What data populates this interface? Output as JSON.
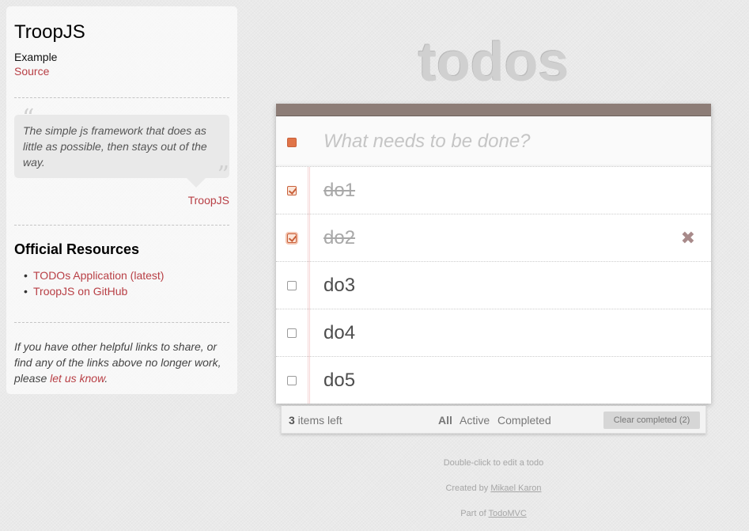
{
  "sidebar": {
    "title": "TroopJS",
    "example_label": "Example",
    "source_link": "Source",
    "quote_open": "“",
    "quote_text": "The simple js framework that does as little as possible, then stays out of the way.",
    "quote_close": "”",
    "quote_author": "TroopJS",
    "resources_title": "Official Resources",
    "resources": [
      {
        "label": "TODOs Application (latest)"
      },
      {
        "label": "TroopJS on GitHub"
      }
    ],
    "footer_prefix": "If you have other helpful links to share, or find any of the links above no longer work, please ",
    "footer_link": "let us know",
    "footer_suffix": "."
  },
  "app": {
    "title": "todos",
    "new_todo_placeholder": "What needs to be done?",
    "todos": [
      {
        "label": "do1",
        "completed": true
      },
      {
        "label": "do2",
        "completed": true
      },
      {
        "label": "do3",
        "completed": false
      },
      {
        "label": "do4",
        "completed": false
      },
      {
        "label": "do5",
        "completed": false
      }
    ],
    "destroy_glyph": "✖",
    "footer": {
      "count": "3",
      "count_suffix": " items left",
      "filters": [
        "All",
        "Active",
        "Completed"
      ],
      "selected_filter": "All",
      "clear_label": "Clear completed (2)"
    }
  },
  "info": {
    "hint": "Double-click to edit a todo",
    "created_prefix": "Created by ",
    "created_author": "Mikael Karon",
    "part_prefix": "Part of ",
    "part_link": "TodoMVC"
  },
  "colors": {
    "accent": "#b83f45",
    "topbar": "#8d7d77",
    "checkbox_done": "#c9603a"
  }
}
